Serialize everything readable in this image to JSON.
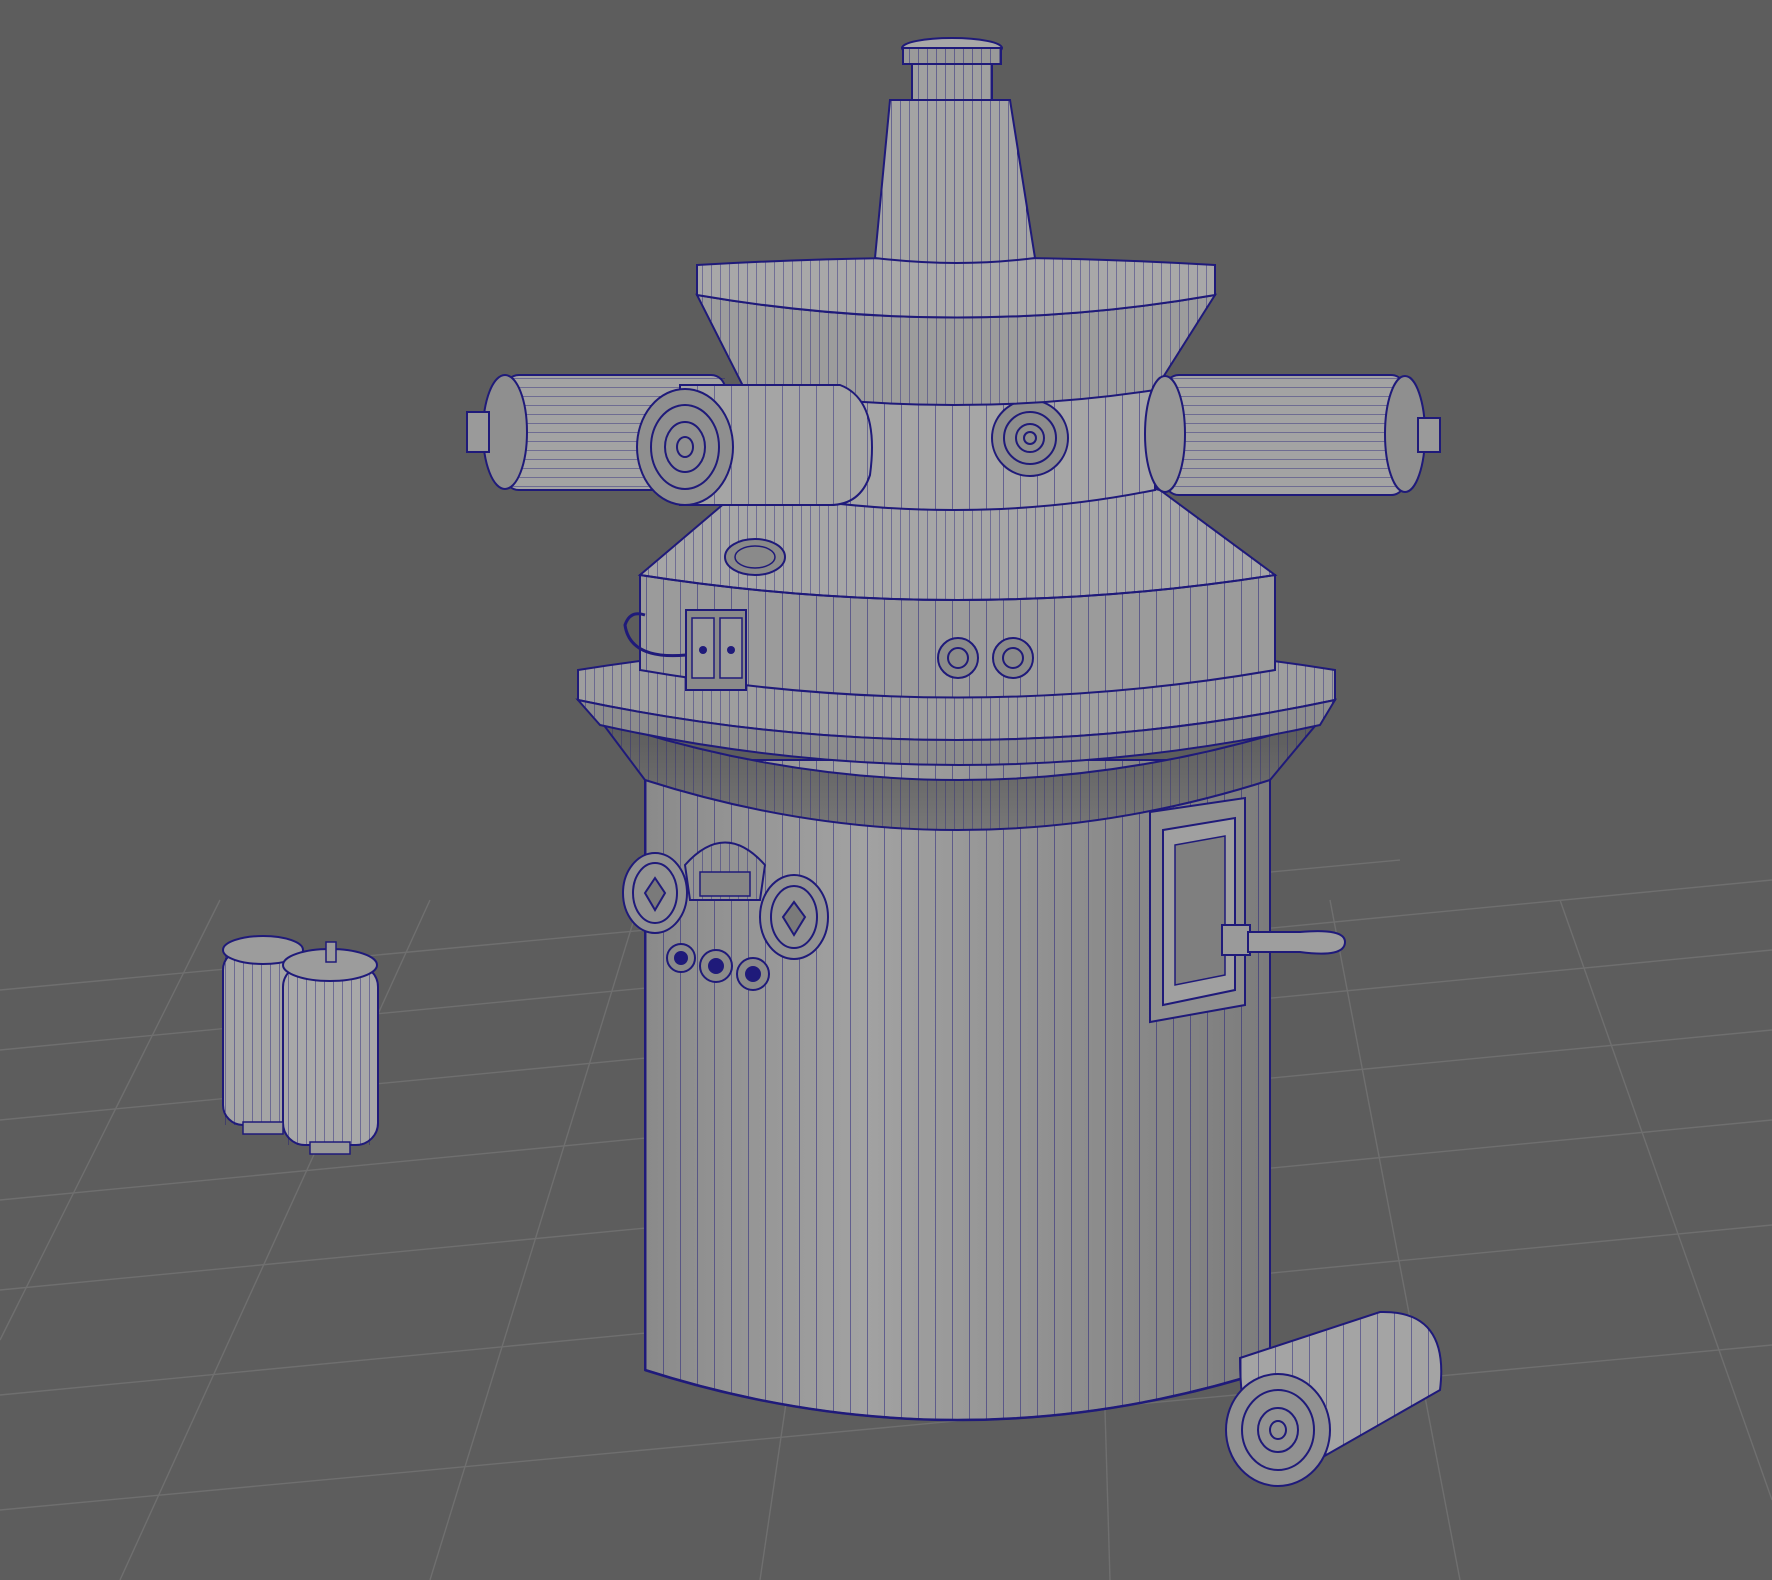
{
  "viewport": {
    "panel": "3D viewport",
    "display_mode": "wireframe-on-shaded",
    "background_color": "#5d5d5d",
    "grid_color": "#6f6f6f",
    "shading_color": "#9a9a9a",
    "wire_color": "#1f1a7a"
  },
  "scene": {
    "objects": [
      {
        "name": "machine-body"
      },
      {
        "name": "top-nozzle"
      },
      {
        "name": "upper-collar"
      },
      {
        "name": "side-canister-left"
      },
      {
        "name": "side-canister-right"
      },
      {
        "name": "front-canister"
      },
      {
        "name": "lower-dome"
      },
      {
        "name": "mid-flange"
      },
      {
        "name": "gauge-panel"
      },
      {
        "name": "lever-switch"
      },
      {
        "name": "floor-canister-pair"
      },
      {
        "name": "fallen-canister"
      }
    ]
  }
}
